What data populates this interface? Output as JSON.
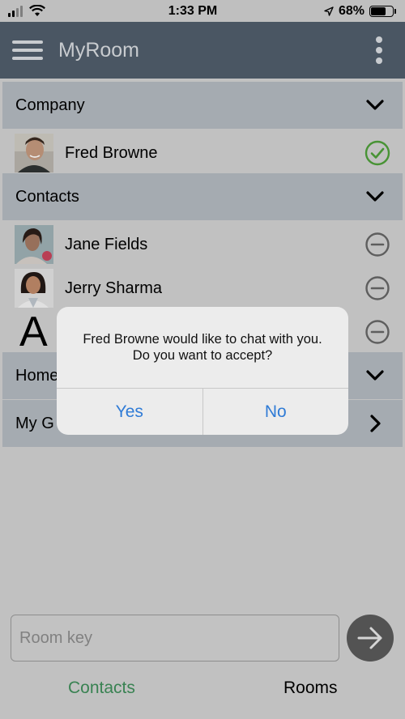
{
  "status_bar": {
    "time": "1:33 PM",
    "battery": "68%",
    "battery_level": 0.68
  },
  "app_bar": {
    "title": "MyRoom",
    "menu_icon": "hamburger-icon",
    "more_icon": "more-vertical-icon"
  },
  "sections": {
    "company": {
      "label": "Company",
      "chevron": "chevron-down-icon"
    },
    "contacts": {
      "label": "Contacts",
      "chevron": "chevron-down-icon"
    },
    "home": {
      "label": "Home",
      "chevron": "chevron-down-icon"
    },
    "my_g": {
      "label": "My G",
      "chevron": "chevron-right-icon"
    }
  },
  "rows": {
    "fred": {
      "name": "Fred Browne",
      "status": "online-check-icon"
    },
    "jane": {
      "name": "Jane Fields",
      "status": "offline-minus-icon"
    },
    "jerry": {
      "name": "Jerry Sharma",
      "status": "offline-minus-icon"
    },
    "a_contact": {
      "initial": "A",
      "status": "offline-minus-icon"
    }
  },
  "bottom": {
    "room_key_placeholder": "Room key",
    "go_icon": "arrow-right-icon",
    "tab_contacts": "Contacts",
    "tab_rooms": "Rooms"
  },
  "dialog": {
    "message": "Fred Browne would like to chat with you.  Do you want to accept?",
    "yes": "Yes",
    "no": "No"
  },
  "colors": {
    "app_bar": "#515e6c",
    "section_header": "#b4bac1",
    "accent_green": "#3e8e5a",
    "online_green": "#4fa03a",
    "dialog_button": "#2f7bd6"
  }
}
